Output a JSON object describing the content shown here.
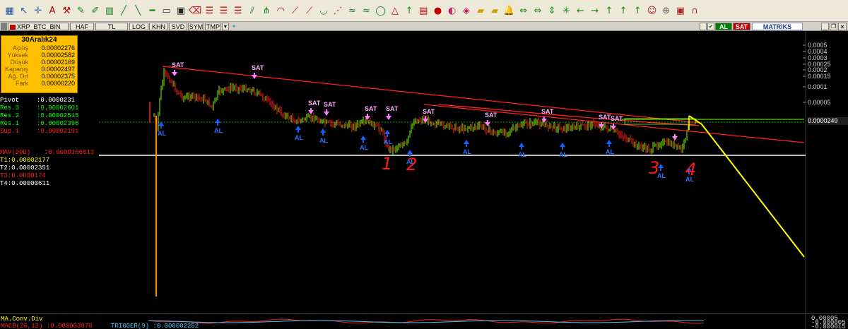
{
  "toolbar": {
    "icons": [
      "grid-icon",
      "cursor-arrow-icon",
      "crosshair-icon",
      "text-label-icon",
      "tools-icon",
      "pencil-icon",
      "pen-icon",
      "chart-type-icon",
      "line-tool-icon",
      "trend-down-icon",
      "horizontal-line-icon",
      "rectangle-icon",
      "window-icon",
      "eraser-icon",
      "fibonacci-icon",
      "fibonacci-icon",
      "fibonacci-icon",
      "channel-icon",
      "andrews-icon",
      "arc-icon",
      "gann-icon",
      "gann-icon",
      "cycle-icon",
      "speed-icon",
      "regression-icon",
      "regression-icon",
      "ellipse-icon",
      "triangle-icon",
      "arrow-up-icon",
      "text-box-icon",
      "circle-icon",
      "palette-icon",
      "paint-icon",
      "yellow-note-icon",
      "yellow-note-icon",
      "bell-icon",
      "move-left-right-icon",
      "move-left-right-icon",
      "move-up-down-icon",
      "zoom-in-icon",
      "arrow-left-icon",
      "arrow-right-icon",
      "arrow-up-icon",
      "arrow-up-icon",
      "arrow-up-icon",
      "user-icon",
      "search-icon",
      "picture-icon",
      "magnet-icon"
    ]
  },
  "tabs": [
    {
      "label": "XRP_BTC_BIN"
    },
    {
      "label": "HAF"
    },
    {
      "label": "TL"
    },
    {
      "label": "LOG"
    },
    {
      "label": "KHN"
    },
    {
      "label": "SVD"
    },
    {
      "label": "SYM"
    },
    {
      "label": "TMP"
    }
  ],
  "tabbar_right": {
    "al_label": "AL",
    "sat_label": "SAT",
    "brand": "MATRiKS"
  },
  "info_box": {
    "date": "30Aralık24",
    "rows": [
      {
        "label": "Açılış",
        "value": "0.00002276"
      },
      {
        "label": "Yüksek",
        "value": "0.00002582"
      },
      {
        "label": "Düşük",
        "value": "0.00002169"
      },
      {
        "label": "Kapanış",
        "value": "0.00002497"
      },
      {
        "label": "Ağ. Ort",
        "value": "0.00002375"
      },
      {
        "label": "Fark",
        "value": "0.00000220"
      }
    ]
  },
  "pivots": [
    {
      "label": "Pivot",
      "value": ":0.0000231",
      "color": "#ffffff",
      "vcolor": "#ffffff"
    },
    {
      "label": "Res.3",
      "value": ":0.00002601",
      "color": "#00ff00",
      "vcolor": "#00ff00"
    },
    {
      "label": "Res.2",
      "value": ":0.00002515",
      "color": "#00ff00",
      "vcolor": "#00ff00"
    },
    {
      "label": "Res.1",
      "value": ":0.00002396",
      "color": "#00ff00",
      "vcolor": "#00ff00"
    },
    {
      "label": "Sup.1",
      "value": ":0.00002191",
      "color": "#ff2020",
      "vcolor": "#ff2020"
    }
  ],
  "targets": [
    {
      "label": "MAV(200)",
      "value": ":0.0000166813",
      "color": "#ff2020"
    },
    {
      "label": "T1",
      "value": ":0.00002177",
      "color": "#ffff00"
    },
    {
      "label": "T2",
      "value": ":0.00002351",
      "color": "#ffffff"
    },
    {
      "label": "T3",
      "value": ":0.0000174",
      "color": "#ff2020"
    },
    {
      "label": "T4",
      "value": ":0.00000611",
      "color": "#ffffff"
    }
  ],
  "right_axis": {
    "ticks": [
      "0.0005",
      "0.0004",
      "0.0003",
      "0.00025",
      "0.0002",
      "0.00015",
      "0.0001",
      "0.00005"
    ],
    "current_price": "0.0000249"
  },
  "signals": {
    "sat_label": "SAT",
    "al_label": "AL",
    "handwritten": [
      "1",
      "2",
      "3",
      "4"
    ]
  },
  "indicator": {
    "name": "MA.Conv.Div",
    "macd_label": "MACD(26,12)",
    "macd_value": ":0.000003878",
    "trigger_label": "TRIGGER(9)",
    "trigger_value": ":0.000002252",
    "axis_values": [
      "0.00005",
      "-0.000005",
      "-0.000015"
    ]
  },
  "colors": {
    "toolbar_bg": "#ece9d8",
    "info_box_bg": "#ffc000",
    "bull_candle": "#7fff00",
    "bear_candle": "#ff2020",
    "sat_arrow": "#ff80ff",
    "al_arrow": "#1060ff",
    "trend_line": "#ff2020",
    "projection_line": "#ffff00",
    "support_line": "#ffffff"
  }
}
